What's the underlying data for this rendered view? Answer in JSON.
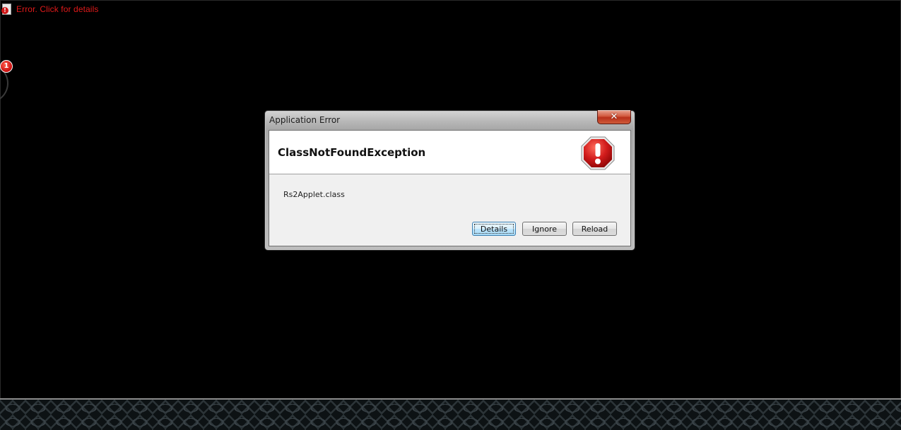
{
  "applet": {
    "status_text": "Error.  Click for details",
    "notification_count": "1"
  },
  "dialog": {
    "title": "Application Error",
    "exception": "ClassNotFoundException",
    "message": "Rs2Applet.class",
    "buttons": {
      "details": "Details",
      "ignore": "Ignore",
      "reload": "Reload"
    },
    "icon": "stop-error-icon",
    "close_glyph": "✕"
  },
  "colors": {
    "background": "#000000",
    "status_text": "#e01a1a",
    "stop_icon": "#d11b1b"
  }
}
